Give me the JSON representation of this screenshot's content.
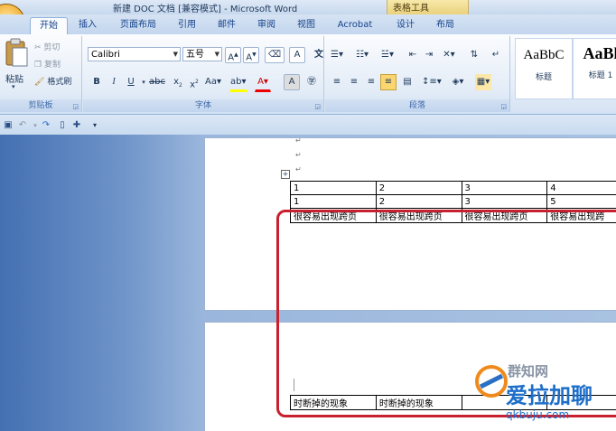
{
  "window": {
    "title": "新建 DOC 文档 [兼容模式] - Microsoft Word",
    "context_group": "表格工具"
  },
  "tabs": [
    {
      "label": "开始",
      "active": true
    },
    {
      "label": "插入"
    },
    {
      "label": "页面布局"
    },
    {
      "label": "引用"
    },
    {
      "label": "邮件"
    },
    {
      "label": "审阅"
    },
    {
      "label": "视图"
    },
    {
      "label": "Acrobat"
    },
    {
      "label": "设计"
    },
    {
      "label": "布局"
    }
  ],
  "clipboard": {
    "paste": "粘贴",
    "cut": "剪切",
    "copy": "复制",
    "format_painter": "格式刷",
    "label": "剪贴板"
  },
  "font": {
    "name": "Calibri",
    "size": "五号",
    "label": "字体"
  },
  "paragraph": {
    "label": "段落"
  },
  "styles": [
    {
      "sample": "AaBbC",
      "name": "标题"
    },
    {
      "sample": "AaBl",
      "name": "标题 1"
    }
  ],
  "document": {
    "table1": [
      [
        "1",
        "2",
        "3",
        "4"
      ],
      [
        "1",
        "2",
        "3",
        "5"
      ],
      [
        "很容易出现跨页",
        "很容易出现跨页",
        "很容易出现跨页",
        "很容易出现跨"
      ]
    ],
    "table2": [
      [
        "时断掉的现象",
        "时断掉的现象",
        "",
        ""
      ]
    ]
  },
  "watermark": {
    "brand": "爱拉加聊",
    "site": "qkbuju.com",
    "cn": "群知网"
  },
  "colors": {
    "highlight": "#c8202e",
    "accent": "#15428b"
  }
}
